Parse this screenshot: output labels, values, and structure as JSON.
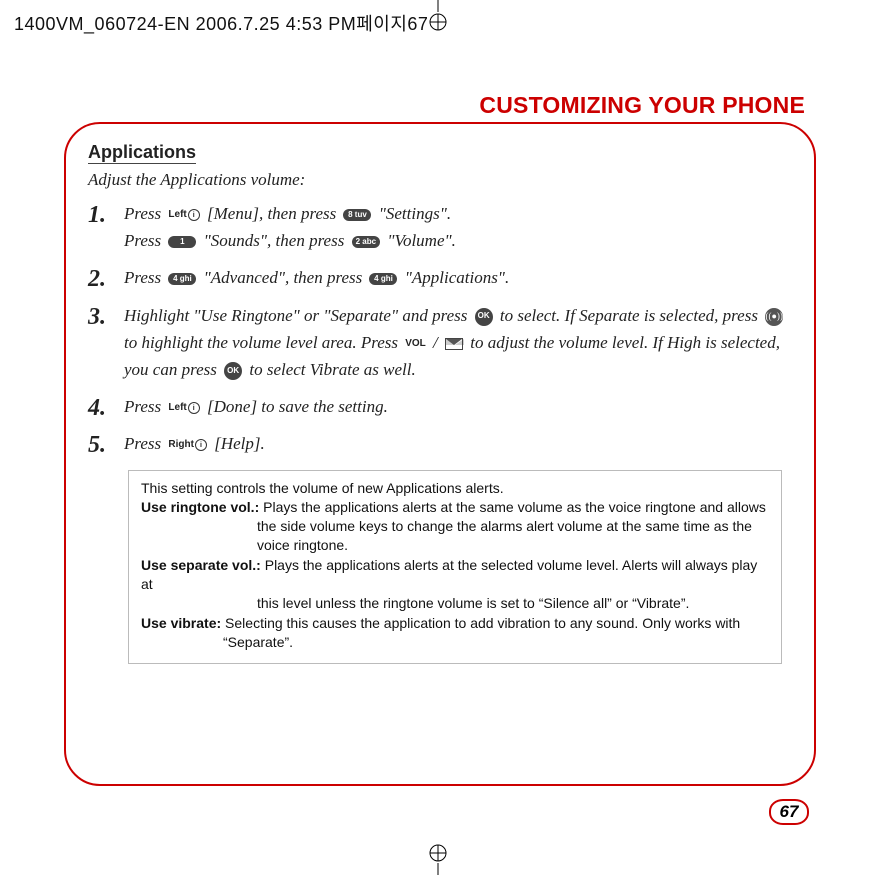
{
  "print_header": "1400VM_060724-EN  2006.7.25 4:53 PM페이지67",
  "section_title": "CUSTOMIZING YOUR PHONE",
  "applications": {
    "heading": "Applications",
    "subhead": "Adjust the Applications volume:",
    "steps": {
      "s1a": "Press ",
      "s1a_key_left": "Left",
      "s1b": " [Menu], then press ",
      "s1b_key": "8 tuv",
      "s1c": " \"Settings\".",
      "s1d": "Press ",
      "s1d_key": "1",
      "s1e": " \"Sounds\", then press ",
      "s1e_key": "2 abc",
      "s1f": " \"Volume\".",
      "s2a": "Press ",
      "s2a_key": "4 ghi",
      "s2b": " \"Advanced\", then press ",
      "s2b_key": "4 ghi",
      "s2c": " \"Applications\".",
      "s3a": "Highlight \"Use Ringtone\" or \"Separate\" and press ",
      "s3a_key": "OK",
      "s3b": " to select.  If Separate is selected, press ",
      "s3c": " to highlight the volume level area.  Press ",
      "s3c_key1": "VOL",
      "s3c_slash": " / ",
      "s3d": " to adjust the volume level.  If High is selected, you can press ",
      "s3d_key": "OK",
      "s3e": " to select Vibrate as well.",
      "s4a": "Press ",
      "s4a_key_left": "Left",
      "s4b": " [Done] to save the setting.",
      "s5a": "Press ",
      "s5a_key_right": "Right",
      "s5b": " [Help]."
    },
    "note": {
      "intro": "This setting controls the volume of new Applications alerts.",
      "r1_label": "Use ringtone vol.:",
      "r1_text": " Plays the applications alerts at the same volume as the voice ringtone and allows",
      "r1_cont1": "the side volume keys to change the alarms alert volume at the same time as the",
      "r1_cont2": "voice ringtone.",
      "r2_label": "Use separate vol.:",
      "r2_text": " Plays the applications alerts at the selected volume level. Alerts will always play at",
      "r2_cont1": "this level unless the ringtone volume is set to “Silence all” or “Vibrate”.",
      "r3_label": "Use vibrate:",
      "r3_text": " Selecting this causes the application to add vibration to any sound. Only works with",
      "r3_cont1": "“Separate”."
    }
  },
  "page_number": "67"
}
